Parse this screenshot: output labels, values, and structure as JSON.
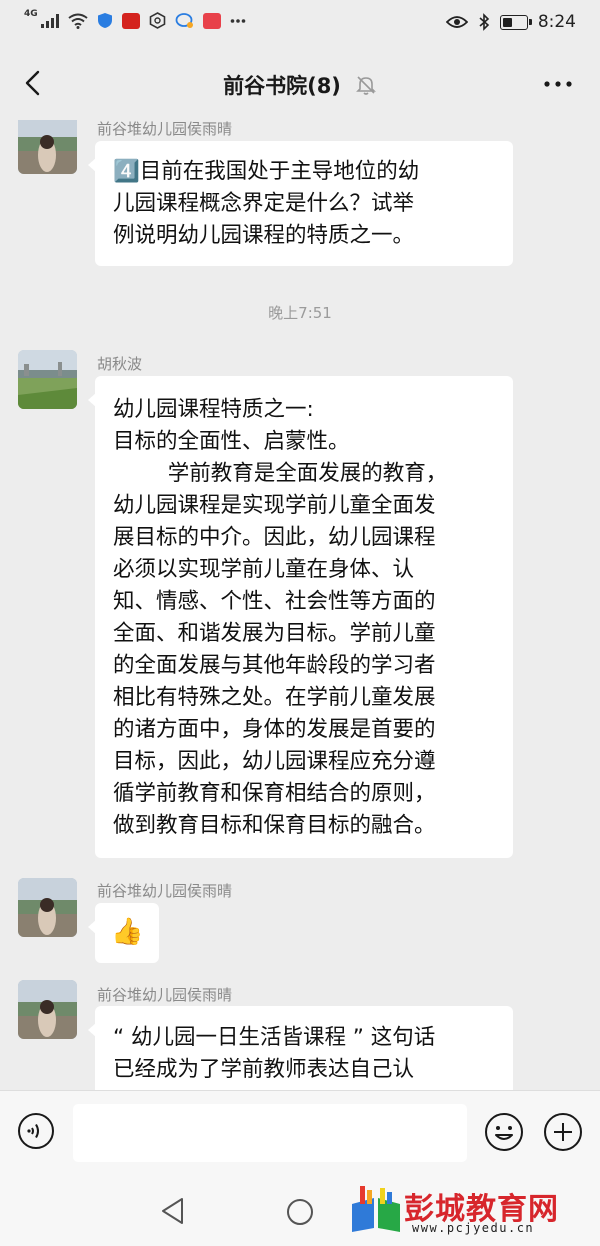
{
  "status_bar": {
    "signal": "4G",
    "time": "8:24",
    "icons": [
      "signal-icon",
      "wifi-icon",
      "shield-app-icon",
      "app-icon-red",
      "hexagon-app-icon",
      "chat-app-icon",
      "app-icon-red-2",
      "more-dots-icon",
      "eye-icon",
      "bluetooth-icon",
      "battery-icon"
    ]
  },
  "header": {
    "title": "前谷书院(8)",
    "icons": [
      "back-arrow-icon",
      "mute-bell-icon",
      "more-options-icon"
    ]
  },
  "messages": [
    {
      "sender": "前谷堆幼儿园侯雨晴",
      "text": "4️⃣目前在我国处于主导地位的幼\n儿园课程概念界定是什么？试举\n例说明幼儿园课程的特质之一。"
    },
    {
      "timestamp": "晚上7:51"
    },
    {
      "sender": "胡秋波",
      "text": "幼儿园课程特质之一:\n目标的全面性、启蒙性。\n        学前教育是全面发展的教育，\n幼儿园课程是实现学前儿童全面发\n展目标的中介。因此，幼儿园课程\n必须以实现学前儿童在身体、认\n知、情感、个性、社会性等方面的\n全面、和谐发展为目标。学前儿童\n的全面发展与其他年龄段的学习者\n相比有特殊之处。在学前儿童发展\n的诸方面中，身体的发展是首要的\n目标，因此，幼儿园课程应充分遵\n循学前教育和保育相结合的原则，\n做到教育目标和保育目标的融合。"
    },
    {
      "sender": "前谷堆幼儿园侯雨晴",
      "emoji": "👍"
    },
    {
      "sender": "前谷堆幼儿园侯雨晴",
      "text": "“ 幼儿园一日生活皆课程 ” 这句话\n已经成为了学前教师表达自己认"
    }
  ],
  "input_bar": {
    "value": "",
    "icons": [
      "voice-icon",
      "emoji-icon",
      "plus-icon"
    ]
  },
  "nav_bar": {
    "icons": [
      "nav-back-icon",
      "nav-home-icon"
    ]
  },
  "watermark": {
    "title": "彭城教育网",
    "url": "www.pcjyedu.cn"
  },
  "colors": {
    "chat_background": "#ededed",
    "bubble": "#ffffff",
    "watermark_red": "#d7262c"
  }
}
